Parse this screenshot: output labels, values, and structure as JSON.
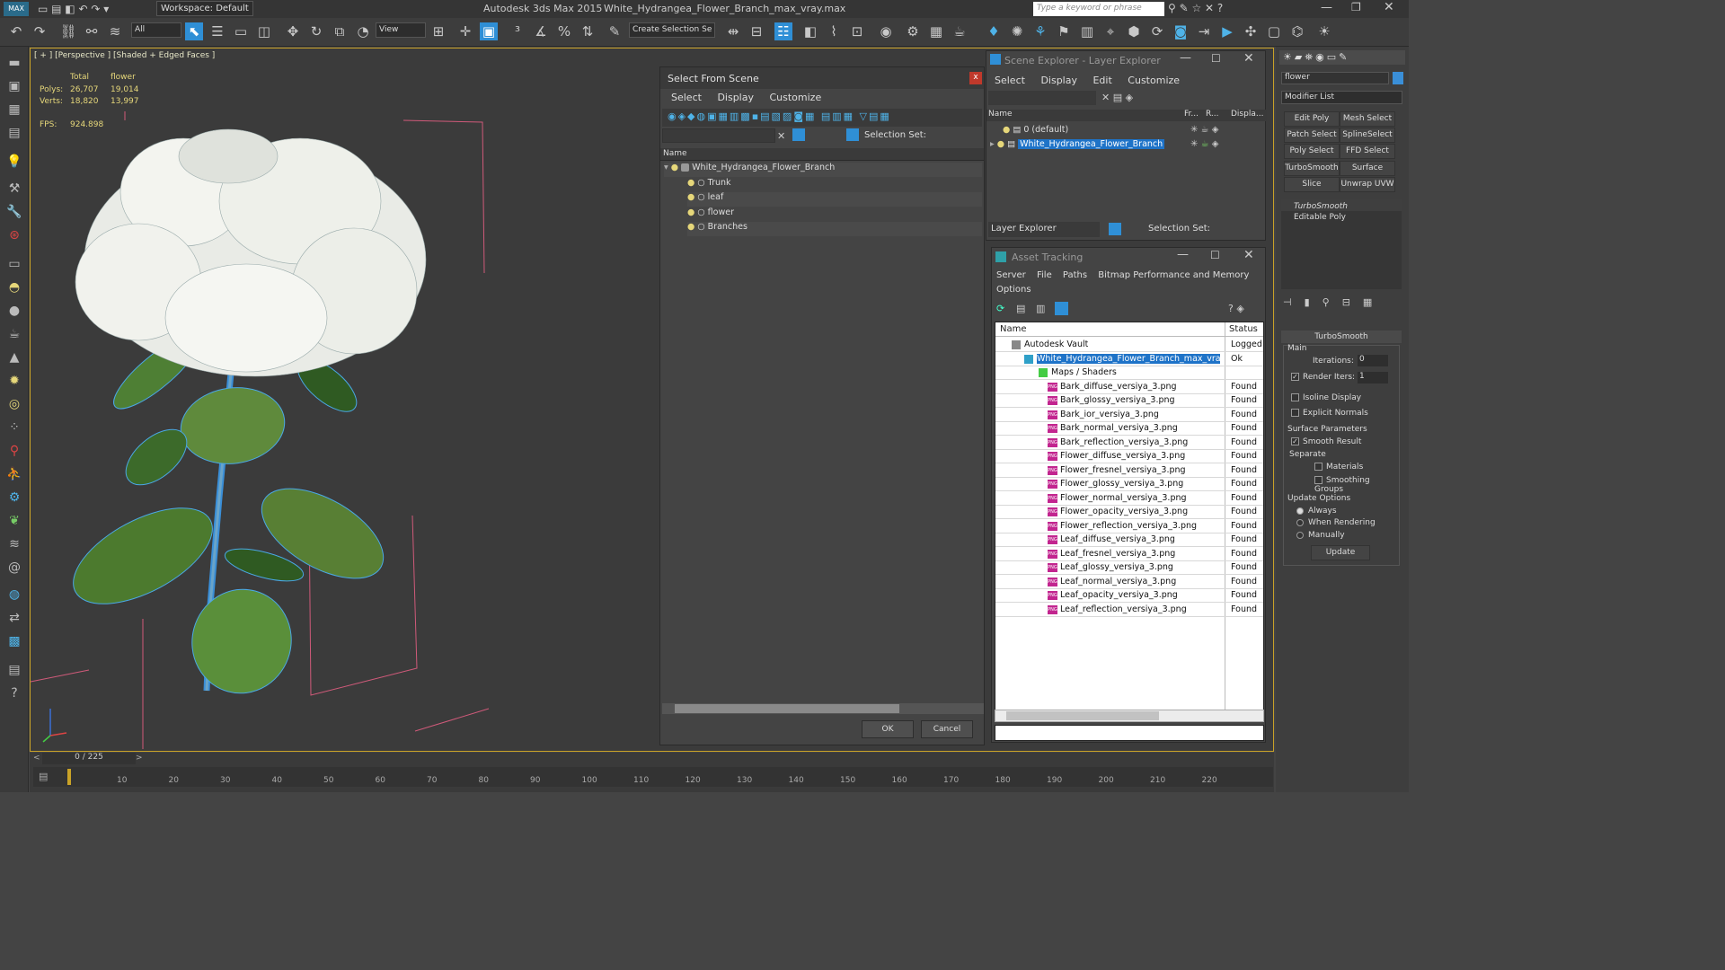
{
  "app": {
    "title": "Autodesk 3ds Max  2015",
    "file": "White_Hydrangea_Flower_Branch_max_vray.max",
    "workspace": "Workspace: Default",
    "search_placeholder": "Type a keyword or phrase",
    "filter": "All",
    "view_dropdown": "View",
    "selection_set_field": "Create Selection Se"
  },
  "viewport": {
    "label": "[ + ] [Perspective ] [Shaded + Edged Faces ]",
    "stats": {
      "col_total": "Total",
      "col_flower": "flower",
      "polys_label": "Polys:",
      "polys_total": "26,707",
      "polys_flower": "19,014",
      "verts_label": "Verts:",
      "verts_total": "18,820",
      "verts_flower": "13,997",
      "fps_label": "FPS:",
      "fps_value": "924.898"
    }
  },
  "select_from_scene": {
    "title": "Select From Scene",
    "menu": [
      "Select",
      "Display",
      "Customize"
    ],
    "selection_set_label": "Selection Set:",
    "column_name": "Name",
    "tree": [
      "White_Hydrangea_Flower_Branch",
      "Trunk",
      "leaf",
      "flower",
      "Branches"
    ],
    "ok": "OK",
    "cancel": "Cancel"
  },
  "scene_explorer": {
    "title": "Scene Explorer - Layer Explorer",
    "menu": [
      "Select",
      "Display",
      "Edit",
      "Customize"
    ],
    "columns": [
      "Name",
      "Fr...",
      "R...",
      "Displa..."
    ],
    "layers": [
      "0 (default)",
      "White_Hydrangea_Flower_Branch"
    ],
    "footer_dropdown": "Layer Explorer",
    "selection_set_label": "Selection Set:"
  },
  "asset_tracking": {
    "title": "Asset Tracking",
    "menu": [
      "Server",
      "File",
      "Paths",
      "Bitmap Performance and Memory",
      "Options"
    ],
    "columns": [
      "Name",
      "Status"
    ],
    "vault": {
      "name": "Autodesk Vault",
      "status": "Logged"
    },
    "file": {
      "name": "White_Hydrangea_Flower_Branch_max_vray....",
      "status": "Ok"
    },
    "group": "Maps / Shaders",
    "maps": [
      {
        "name": "Bark_diffuse_versiya_3.png",
        "status": "Found"
      },
      {
        "name": "Bark_glossy_versiya_3.png",
        "status": "Found"
      },
      {
        "name": "Bark_ior_versiya_3.png",
        "status": "Found"
      },
      {
        "name": "Bark_normal_versiya_3.png",
        "status": "Found"
      },
      {
        "name": "Bark_reflection_versiya_3.png",
        "status": "Found"
      },
      {
        "name": "Flower_diffuse_versiya_3.png",
        "status": "Found"
      },
      {
        "name": "Flower_fresnel_versiya_3.png",
        "status": "Found"
      },
      {
        "name": "Flower_glossy_versiya_3.png",
        "status": "Found"
      },
      {
        "name": "Flower_normal_versiya_3.png",
        "status": "Found"
      },
      {
        "name": "Flower_opacity_versiya_3.png",
        "status": "Found"
      },
      {
        "name": "Flower_reflection_versiya_3.png",
        "status": "Found"
      },
      {
        "name": "Leaf_diffuse_versiya_3.png",
        "status": "Found"
      },
      {
        "name": "Leaf_fresnel_versiya_3.png",
        "status": "Found"
      },
      {
        "name": "Leaf_glossy_versiya_3.png",
        "status": "Found"
      },
      {
        "name": "Leaf_normal_versiya_3.png",
        "status": "Found"
      },
      {
        "name": "Leaf_opacity_versiya_3.png",
        "status": "Found"
      },
      {
        "name": "Leaf_reflection_versiya_3.png",
        "status": "Found"
      }
    ]
  },
  "command_panel": {
    "object_name": "flower",
    "modifier_list": "Modifier List",
    "buttons": [
      "Edit Poly",
      "Mesh Select",
      "Patch Select",
      "SplineSelect",
      "Poly Select",
      "FFD Select",
      "TurboSmooth",
      "Surface Select",
      "Slice",
      "Unwrap UVW"
    ],
    "stack": [
      "TurboSmooth",
      "Editable Poly"
    ],
    "rollout_title": "TurboSmooth",
    "main_label": "Main",
    "iterations_label": "Iterations:",
    "iterations_value": "0",
    "render_iters_label": "Render Iters:",
    "render_iters_value": "1",
    "isoline_label": "Isoline Display",
    "explicit_normals_label": "Explicit Normals",
    "surface_params_label": "Surface Parameters",
    "smooth_result_label": "Smooth Result",
    "separate_label": "Separate",
    "materials_label": "Materials",
    "smoothing_groups_label": "Smoothing Groups",
    "update_options_label": "Update Options",
    "always_label": "Always",
    "when_rendering_label": "When Rendering",
    "manually_label": "Manually",
    "update_button": "Update"
  },
  "timeline": {
    "frame_counter": "0 / 225",
    "ticks": [
      "10",
      "20",
      "30",
      "40",
      "50",
      "60",
      "70",
      "80",
      "90",
      "100",
      "110",
      "120",
      "130",
      "140",
      "150",
      "160",
      "170",
      "180",
      "190",
      "200",
      "210",
      "220"
    ]
  },
  "colors": {
    "accent": "#2f8fd6",
    "selected_row": "#1e73c8",
    "viewport_border": "#c9a227"
  }
}
